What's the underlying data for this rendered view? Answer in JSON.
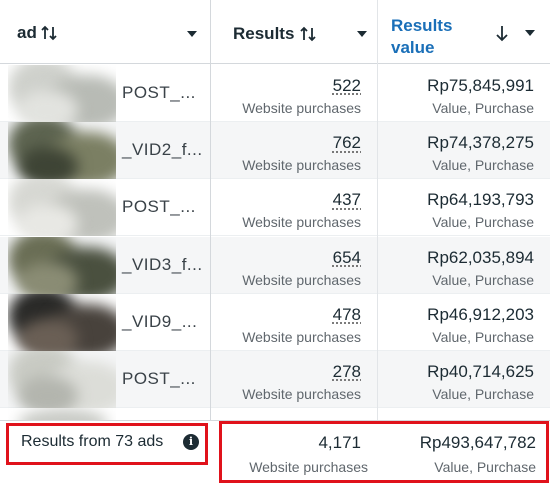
{
  "header": {
    "ad_label": "ad",
    "results_label": "Results",
    "results_value_label": "Results value",
    "sort_icon": "sort-arrows-icon",
    "sort_desc_icon": "arrow-down-icon",
    "dropdown_icon": "caret-down-icon"
  },
  "rows": [
    {
      "name": "POST_...",
      "results": "522",
      "results_sub": "Website purchases",
      "value": "Rp75,845,991",
      "value_sub": "Value, Purchase"
    },
    {
      "name": "_VID2_f...",
      "results": "762",
      "results_sub": "Website purchases",
      "value": "Rp74,378,275",
      "value_sub": "Value, Purchase"
    },
    {
      "name": "POST_...",
      "results": "437",
      "results_sub": "Website purchases",
      "value": "Rp64,193,793",
      "value_sub": "Value, Purchase"
    },
    {
      "name": "_VID3_f...",
      "results": "654",
      "results_sub": "Website purchases",
      "value": "Rp62,035,894",
      "value_sub": "Value, Purchase"
    },
    {
      "name": "_VID9_...",
      "results": "478",
      "results_sub": "Website purchases",
      "value": "Rp46,912,203",
      "value_sub": "Value, Purchase"
    },
    {
      "name": "POST_...",
      "results": "278",
      "results_sub": "Website purchases",
      "value": "Rp40,714,625",
      "value_sub": "Value, Purchase"
    }
  ],
  "footer": {
    "summary": "Results from 73 ads",
    "info_icon": "info-icon",
    "total_results": "4,171",
    "total_results_sub": "Website purchases",
    "total_value": "Rp493,647,782",
    "total_value_sub": "Value, Purchase"
  },
  "colors": {
    "highlight_border": "#e0121b",
    "sorted_header": "#1a6fb8",
    "text": "#1c2b33",
    "subtext": "#60676d",
    "alt_row": "#f5f6f7"
  }
}
